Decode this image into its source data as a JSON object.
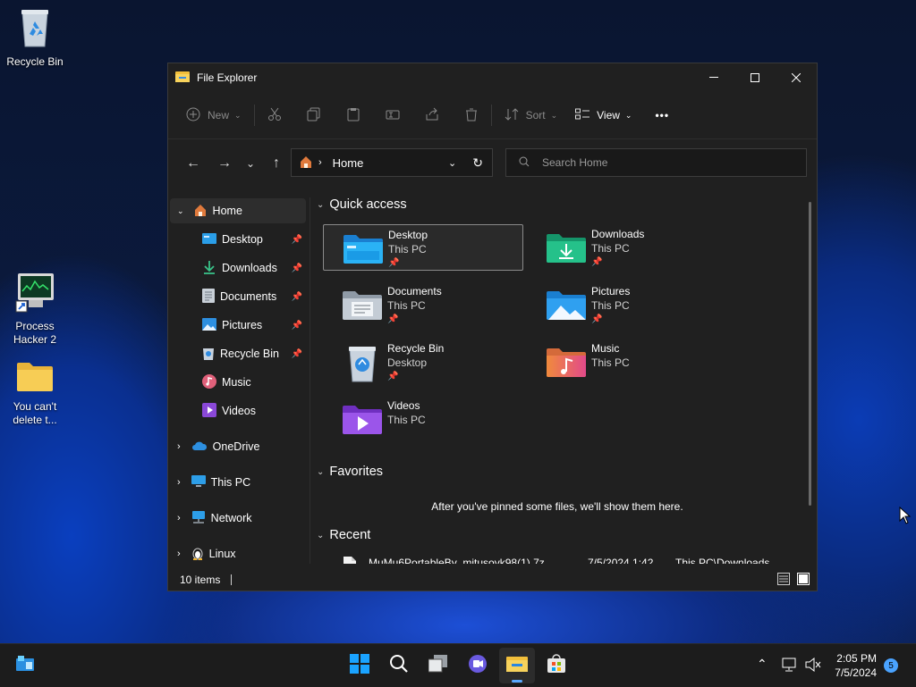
{
  "desktop": {
    "icons": [
      {
        "label": "Recycle Bin"
      },
      {
        "label": "Process Hacker 2"
      },
      {
        "label": "You can't delete t..."
      }
    ]
  },
  "window": {
    "title": "File Explorer",
    "toolbar": {
      "new_label": "New",
      "sort_label": "Sort",
      "view_label": "View",
      "more_label": "•••"
    },
    "address": {
      "current": "Home"
    },
    "search": {
      "placeholder": "Search Home"
    },
    "sidebar": {
      "items": [
        {
          "label": "Home"
        },
        {
          "label": "Desktop"
        },
        {
          "label": "Downloads"
        },
        {
          "label": "Documents"
        },
        {
          "label": "Pictures"
        },
        {
          "label": "Recycle Bin"
        },
        {
          "label": "Music"
        },
        {
          "label": "Videos"
        },
        {
          "label": "OneDrive"
        },
        {
          "label": "This PC"
        },
        {
          "label": "Network"
        },
        {
          "label": "Linux"
        }
      ]
    },
    "content": {
      "quick_access": {
        "title": "Quick access",
        "items": [
          {
            "name": "Desktop",
            "location": "This PC"
          },
          {
            "name": "Downloads",
            "location": "This PC"
          },
          {
            "name": "Documents",
            "location": "This PC"
          },
          {
            "name": "Pictures",
            "location": "This PC"
          },
          {
            "name": "Recycle Bin",
            "location": "Desktop"
          },
          {
            "name": "Music",
            "location": "This PC"
          },
          {
            "name": "Videos",
            "location": "This PC"
          }
        ]
      },
      "favorites": {
        "title": "Favorites",
        "empty_message": "After you've pinned some files, we'll show them here."
      },
      "recent": {
        "title": "Recent",
        "items": [
          {
            "name": "MuMu6PortableBy_mitusovk98(1).7z",
            "date": "7/5/2024 1:42 ...",
            "location": "This PC\\Downloads"
          }
        ]
      }
    },
    "status": {
      "items_count": "10 items"
    }
  },
  "taskbar": {
    "time": "2:05 PM",
    "date": "7/5/2024",
    "notification_count": "5"
  },
  "colors": {
    "accent": "#4aa3ff",
    "window_bg": "#202020"
  }
}
